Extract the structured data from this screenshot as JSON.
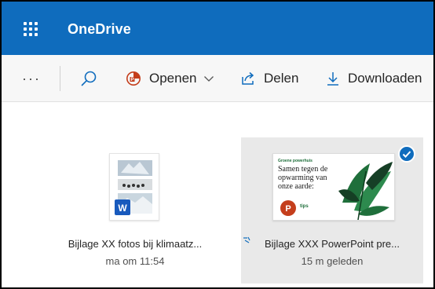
{
  "app": {
    "title": "OneDrive",
    "waffle_icon": "app-launcher-icon"
  },
  "commands": {
    "more": "···",
    "open": "Openen",
    "share": "Delen",
    "download": "Downloaden"
  },
  "files": [
    {
      "name": "Bijlage XX fotos bij klimaatz...",
      "modified": "ma om 11:54",
      "type": "word",
      "selected": false
    },
    {
      "name": "Bijlage XXX PowerPoint pre...",
      "modified": "15 m geleden",
      "type": "powerpoint",
      "selected": true,
      "slide_title": "Samen tegen de opwarming van onze aarde:",
      "slide_kicker": "Groene powerhuis",
      "slide_sub": "tips"
    }
  ],
  "colors": {
    "accent": "#0f6cbd",
    "powerpoint": "#c43e1c",
    "word": "#185abd",
    "slide_green": "#1f6f3b"
  }
}
